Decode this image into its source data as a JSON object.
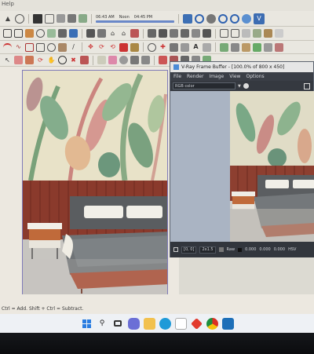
{
  "menu_fragment": "Help",
  "scenes_toolbar": {
    "time_start": "06:43 AM",
    "label_noon": "Noon",
    "time_end": "04:45 PM"
  },
  "vfb": {
    "title": "V-Ray Frame Buffer - [100.0% of 800 x 450]",
    "menu": [
      "File",
      "Render",
      "Image",
      "View",
      "Options"
    ],
    "channel": "RGB color",
    "status_coords": "[0, 0]",
    "status_value": "2x1.5",
    "status_mode": "Raw",
    "status_r": "0.000",
    "status_g": "0.000",
    "status_b": "0.000",
    "status_tag": "HSV"
  },
  "status_hint": "Ctrl = Add. Shift + Ctrl = Subtract.",
  "taskbar": {
    "apps": [
      "windows-start",
      "search",
      "task-view",
      "teams-chat",
      "file-explorer",
      "edge-browser",
      "microsoft-store",
      "red-app",
      "chrome",
      "sketchup"
    ]
  },
  "colors": {
    "wall_panel": "#8a3a2c",
    "bed_frame": "#a8452a",
    "bedding": "#6f7376",
    "vray_accent": "#4b8bd6"
  }
}
